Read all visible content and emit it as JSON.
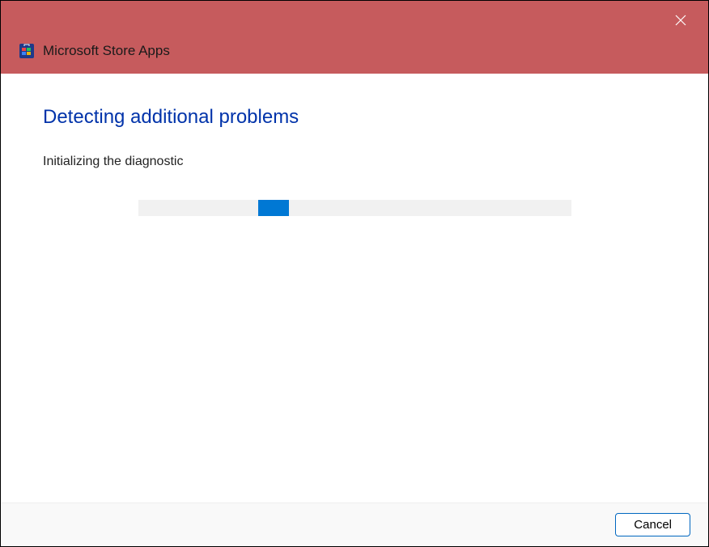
{
  "window": {
    "title": "Microsoft Store Apps"
  },
  "content": {
    "heading": "Detecting additional problems",
    "status": "Initializing the diagnostic"
  },
  "footer": {
    "cancel_label": "Cancel"
  },
  "colors": {
    "titlebar_bg": "#c65b5d",
    "heading_color": "#0033aa",
    "progress_fill": "#0078d4",
    "progress_bg": "#f1f1f1"
  }
}
